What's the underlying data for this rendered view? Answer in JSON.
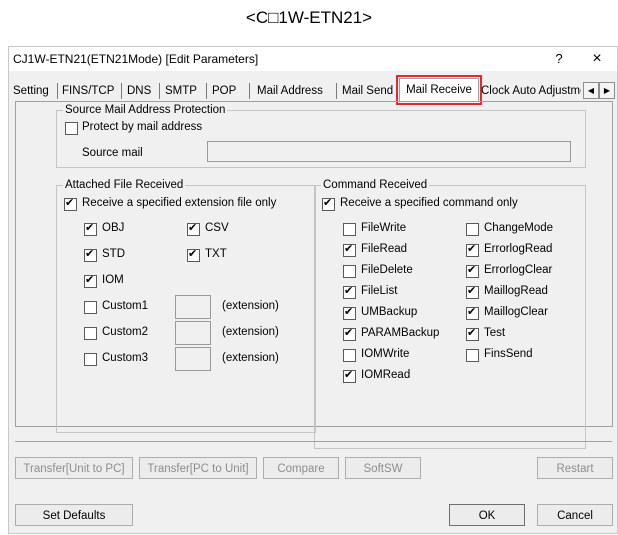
{
  "caption": "<C□1W-ETN21>",
  "window": {
    "title": "CJ1W-ETN21(ETN21Mode) [Edit Parameters]",
    "help_label": "?",
    "close_label": "×"
  },
  "tabs": [
    {
      "label": "Setting"
    },
    {
      "label": "FINS/TCP"
    },
    {
      "label": "DNS"
    },
    {
      "label": "SMTP"
    },
    {
      "label": "POP"
    },
    {
      "label": "Mail Address"
    },
    {
      "label": "Mail Send"
    },
    {
      "label": "Mail Receive",
      "active": true
    },
    {
      "label": "Clock Auto Adjustme"
    }
  ],
  "tab_scroll": {
    "left": "◀",
    "right": "▶"
  },
  "source_protection": {
    "title": "Source Mail Address Protection",
    "protect": {
      "label": "Protect by mail address",
      "checked": false
    },
    "source_label": "Source mail",
    "source_value": ""
  },
  "attached": {
    "title": "Attached File Received",
    "only": {
      "label": "Receive a specified extension file only",
      "checked": true
    },
    "items": [
      {
        "label": "OBJ",
        "checked": true
      },
      {
        "label": "CSV",
        "checked": true
      },
      {
        "label": "STD",
        "checked": true
      },
      {
        "label": "TXT",
        "checked": true
      },
      {
        "label": "IOM",
        "checked": true
      },
      {
        "label": "Custom1",
        "checked": false
      },
      {
        "label": "Custom2",
        "checked": false
      },
      {
        "label": "Custom3",
        "checked": false
      }
    ],
    "extension_label": "(extension)"
  },
  "command": {
    "title": "Command Received",
    "only": {
      "label": "Receive a specified command only",
      "checked": true
    },
    "left": [
      {
        "label": "FileWrite",
        "checked": false
      },
      {
        "label": "FileRead",
        "checked": true
      },
      {
        "label": "FileDelete",
        "checked": false
      },
      {
        "label": "FileList",
        "checked": true
      },
      {
        "label": "UMBackup",
        "checked": true
      },
      {
        "label": "PARAMBackup",
        "checked": true
      },
      {
        "label": "IOMWrite",
        "checked": false
      },
      {
        "label": "IOMRead",
        "checked": true
      }
    ],
    "right": [
      {
        "label": "ChangeMode",
        "checked": false
      },
      {
        "label": "ErrorlogRead",
        "checked": true
      },
      {
        "label": "ErrorlogClear",
        "checked": true
      },
      {
        "label": "MaillogRead",
        "checked": true
      },
      {
        "label": "MaillogClear",
        "checked": true
      },
      {
        "label": "Test",
        "checked": true
      },
      {
        "label": "FinsSend",
        "checked": false
      }
    ]
  },
  "buttons": {
    "transfer_unit_to_pc": "Transfer[Unit to PC]",
    "transfer_pc_to_unit": "Transfer[PC to Unit]",
    "compare": "Compare",
    "softsw": "SoftSW",
    "restart": "Restart",
    "set_defaults": "Set Defaults",
    "ok": "OK",
    "cancel": "Cancel"
  },
  "colors": {
    "highlight": "#e8282e",
    "dialog_bg": "#f0f0f0"
  }
}
